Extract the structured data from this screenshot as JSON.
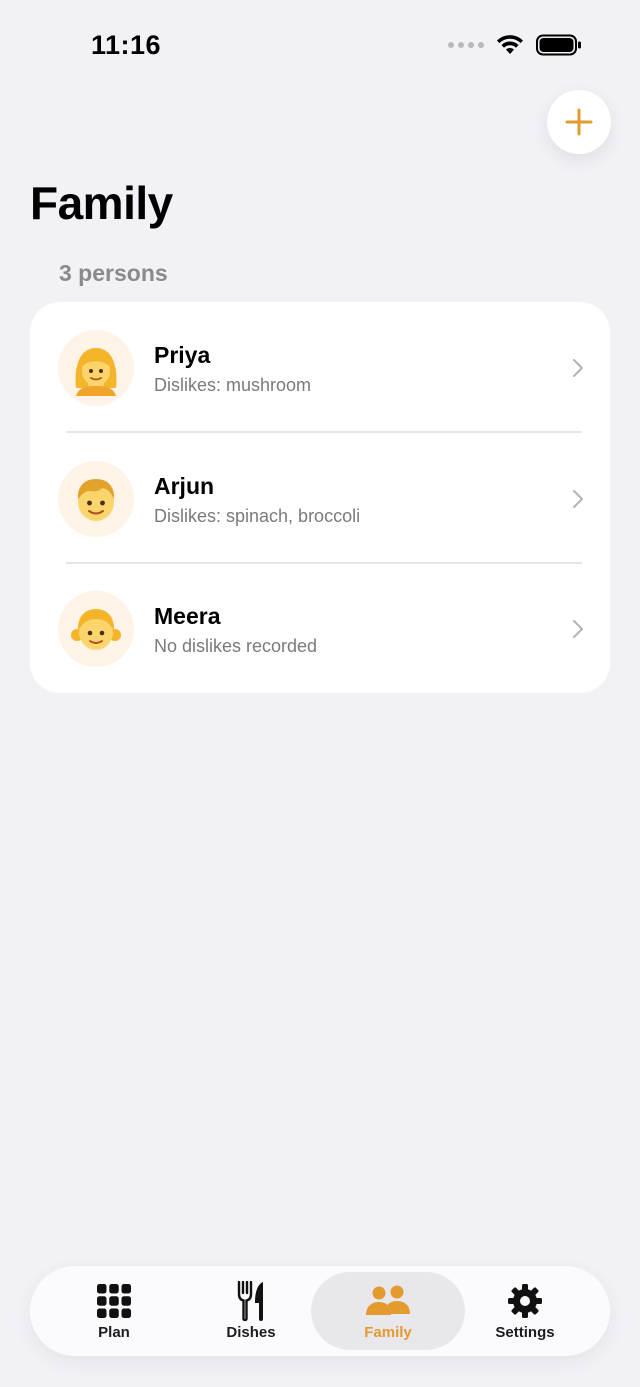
{
  "status_bar": {
    "time": "11:16"
  },
  "header": {
    "title": "Family",
    "count_label": "3 persons",
    "add_icon": "plus-icon"
  },
  "colors": {
    "accent": "#e39a2e",
    "background": "#f1f1f6",
    "card": "#ffffff",
    "secondary_text": "#7a7a7e"
  },
  "members": [
    {
      "name": "Priya",
      "detail": "Dislikes: mushroom",
      "avatar": "woman-emoji"
    },
    {
      "name": "Arjun",
      "detail": "Dislikes: spinach, broccoli",
      "avatar": "boy-emoji"
    },
    {
      "name": "Meera",
      "detail": "No dislikes recorded",
      "avatar": "girl-emoji"
    }
  ],
  "tabs": [
    {
      "label": "Plan",
      "icon": "grid-icon",
      "active": false
    },
    {
      "label": "Dishes",
      "icon": "fork-knife-icon",
      "active": false
    },
    {
      "label": "Family",
      "icon": "people-icon",
      "active": true
    },
    {
      "label": "Settings",
      "icon": "gear-icon",
      "active": false
    }
  ]
}
